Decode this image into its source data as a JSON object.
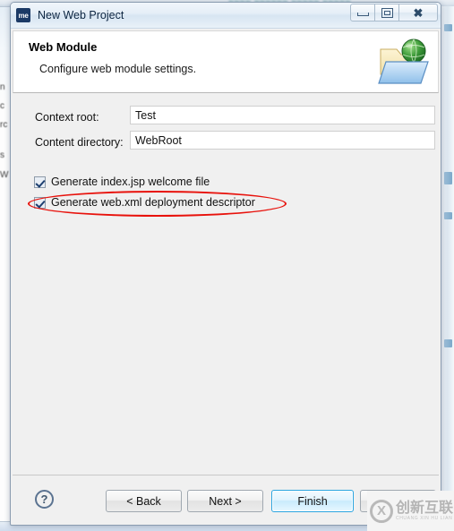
{
  "background": {
    "blur_text_top": "≈≈≈≈ ≈≈≈≈≈≈ ≈≈≈≈≈ ≈≈≈≈≈",
    "blur_text_sub": "≈ ≈≈≈≈≈≈≈≈≈ ≈≈",
    "left_lines": [
      "n",
      "c",
      "rc",
      "s",
      "W"
    ]
  },
  "window": {
    "icon_label": "me",
    "icon_name": "myeclipse-icon",
    "title": "New Web Project",
    "controls": {
      "minimize": "minimize-button",
      "maximize": "maximize-button",
      "close": "close-button"
    }
  },
  "banner": {
    "title": "Web Module",
    "subtitle": "Configure web module settings.",
    "icon_name": "web-folder-globe-icon"
  },
  "form": {
    "fields": [
      {
        "label": "Context root:",
        "value": "Test",
        "name": "context-root"
      },
      {
        "label": "Content directory:",
        "value": "WebRoot",
        "name": "content-directory"
      }
    ],
    "checkboxes": [
      {
        "label": "Generate index.jsp welcome file",
        "checked": true,
        "name": "generate-index-jsp"
      },
      {
        "label": "Generate web.xml deployment descriptor",
        "checked": true,
        "name": "generate-web-xml"
      }
    ]
  },
  "annotation": {
    "shape": "ellipse",
    "color": "#e8120c",
    "target": "Generate web.xml deployment descriptor"
  },
  "footer": {
    "help_label": "?",
    "buttons": [
      {
        "label": "< Back",
        "name": "back-button",
        "default": false
      },
      {
        "label": "Next >",
        "name": "next-button",
        "default": false
      },
      {
        "label": "Finish",
        "name": "finish-button",
        "default": true
      },
      {
        "label": "",
        "name": "cancel-button",
        "default": false
      }
    ]
  },
  "watermark": {
    "mark": "X",
    "chinese": "创新互联",
    "pinyin": "CHUANG XIN HU LIAN"
  },
  "colors": {
    "dialog_bg": "#f0f0f0",
    "banner_bg": "#ffffff",
    "default_button_border": "#2ba5e0",
    "annotation_red": "#e8120c"
  }
}
